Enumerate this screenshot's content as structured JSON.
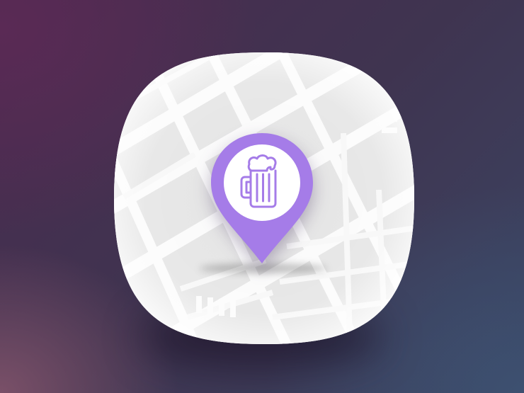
{
  "colors": {
    "pin_fill": "#a57ce8",
    "pin_inner": "#ffffff",
    "glyph_stroke": "#a57ce8",
    "map_background": "#f2f2f2",
    "map_blocks": "#e2e2e2",
    "map_roads": "#fbfbfb"
  },
  "icons": {
    "app": "map-location-app-icon",
    "pin": "location-pin-icon",
    "glyph": "beer-mug-icon"
  }
}
